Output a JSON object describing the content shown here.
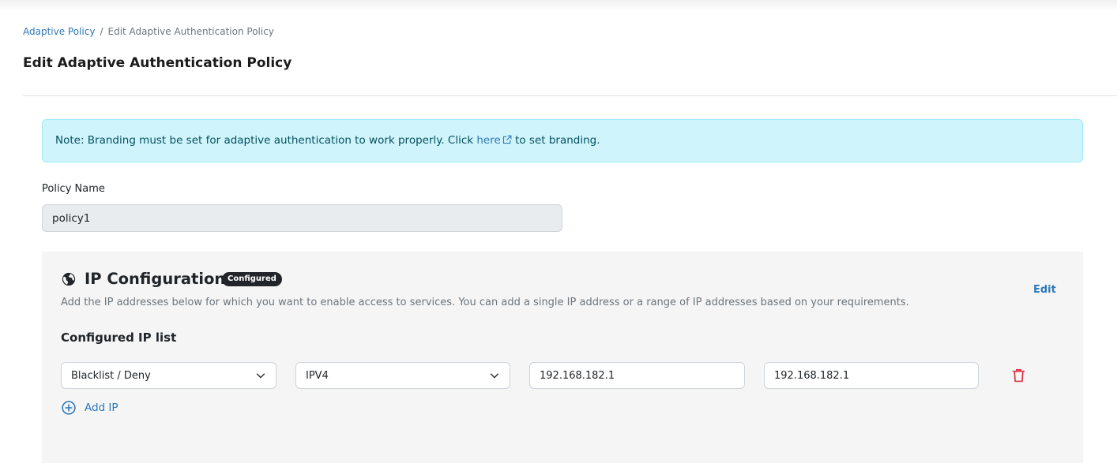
{
  "breadcrumb": {
    "parent": "Adaptive Policy",
    "separator": "/",
    "current": "Edit Adaptive Authentication Policy"
  },
  "page_title": "Edit Adaptive Authentication Policy",
  "note": {
    "text_before": "Note: Branding must be set for adaptive authentication to work properly. Click ",
    "link": "here",
    "text_after": " to set branding."
  },
  "policy": {
    "label": "Policy Name",
    "value": "policy1"
  },
  "ip_config": {
    "title": "IP Configuration",
    "badge": "Configured",
    "edit": "Edit",
    "description": "Add the IP addresses below for which you want to enable access to services. You can add a single IP address or a range of IP addresses based on your requirements.",
    "list_title": "Configured IP list",
    "rows": [
      {
        "access": "Blacklist / Deny",
        "ip_type": "IPV4",
        "start_ip": "192.168.182.1",
        "end_ip": "192.168.182.1"
      }
    ],
    "add_label": "Add IP"
  },
  "colors": {
    "link": "#2e78b6",
    "note_bg": "#cff4fc",
    "danger": "#dc3545",
    "badge_bg": "#212529"
  }
}
